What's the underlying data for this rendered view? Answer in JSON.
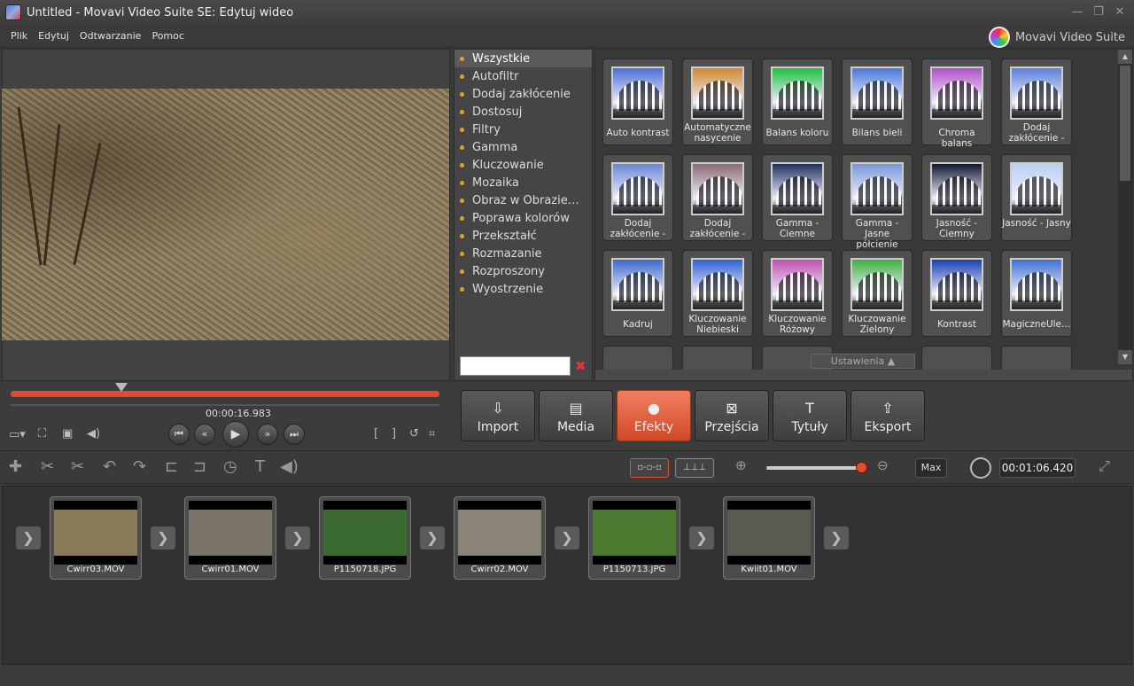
{
  "window": {
    "title": "Untitled - Movavi Video Suite SE: Edytuj wideo",
    "brand": "Movavi Video Suite"
  },
  "menu": [
    "Plik",
    "Edytuj",
    "Odtwarzanie",
    "Pomoc"
  ],
  "categories": [
    "Wszystkie",
    "Autofiltr",
    "Dodaj zakłócenie",
    "Dostosuj",
    "Filtry",
    "Gamma",
    "Kluczowanie",
    "Mozaika",
    "Obraz w Obrazie…",
    "Poprawa kolorów",
    "Przekształć",
    "Rozmazanie",
    "Rozproszony",
    "Wyostrzenie"
  ],
  "selected_category": "Wszystkie",
  "effects": [
    {
      "label": "Auto kontrast",
      "tint": "#4a6ed0"
    },
    {
      "label": "Automatyczne nasycenie",
      "tint": "#d08a30"
    },
    {
      "label": "Balans koloru",
      "tint": "#20c040"
    },
    {
      "label": "Bilans bieli",
      "tint": "#4a78d8"
    },
    {
      "label": "Chroma balans",
      "tint": "#b050c8"
    },
    {
      "label": "Dodaj zakłócenie -",
      "tint": "#5a80d8"
    },
    {
      "label": "Dodaj zakłócenie -",
      "tint": "#6a88d0"
    },
    {
      "label": "Dodaj zakłócenie -",
      "tint": "#8a6a70"
    },
    {
      "label": "Gamma - Ciemne",
      "tint": "#203060"
    },
    {
      "label": "Gamma - Jasne półcienie",
      "tint": "#7898d8"
    },
    {
      "label": "Jasność - Ciemny",
      "tint": "#101830"
    },
    {
      "label": "Jasność - Jasny",
      "tint": "#b8d0f0"
    },
    {
      "label": "Kadruj",
      "tint": "#3a68c8"
    },
    {
      "label": "Kluczowanie Niebieski",
      "tint": "#3060d0"
    },
    {
      "label": "Kluczowanie Różowy",
      "tint": "#c050b0"
    },
    {
      "label": "Kluczowanie Zielony",
      "tint": "#40b040"
    },
    {
      "label": "Kontrast",
      "tint": "#1840b0"
    },
    {
      "label": "MagiczneUle…",
      "tint": "#4070d0"
    }
  ],
  "settings_label": "Ustawienia",
  "timecode": "00:00:16.983",
  "modes": [
    {
      "label": "Import",
      "icon": "⇩"
    },
    {
      "label": "Media",
      "icon": "▤"
    },
    {
      "label": "Efekty",
      "icon": "●"
    },
    {
      "label": "Przejścia",
      "icon": "⊠"
    },
    {
      "label": "Tytuły",
      "icon": "T"
    },
    {
      "label": "Eksport",
      "icon": "⇪"
    }
  ],
  "active_mode": "Efekty",
  "zoom_max_label": "Max",
  "duration": "00:01:06.420",
  "clips": [
    {
      "name": "Cwirr03.MOV",
      "bg": "#8a7a58"
    },
    {
      "name": "Cwirr01.MOV",
      "bg": "#7a7468"
    },
    {
      "name": "P1150718.JPG",
      "bg": "#3a6a30"
    },
    {
      "name": "Cwirr02.MOV",
      "bg": "#8a8478"
    },
    {
      "name": "P1150713.JPG",
      "bg": "#4a7a30"
    },
    {
      "name": "Kwiit01.MOV",
      "bg": "#5a5a50"
    }
  ],
  "colors": {
    "accent": "#e05030",
    "category_dot": "#e8a020"
  }
}
